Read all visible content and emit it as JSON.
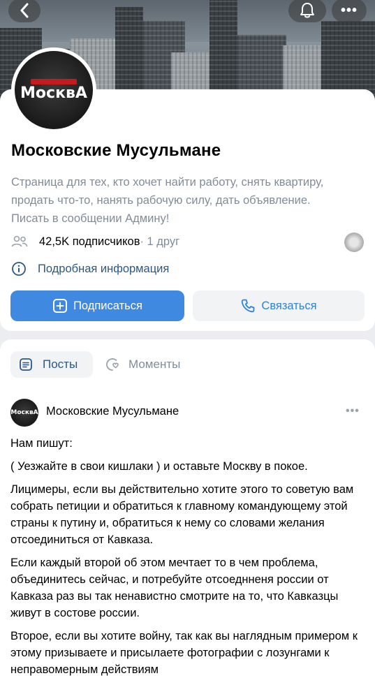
{
  "header": {
    "back_icon": "chevron-left-icon",
    "bell_icon": "bell-icon",
    "more_icon": "more-horizontal-icon",
    "more_label": "•••"
  },
  "profile": {
    "avatar_logo_text": "МосквА",
    "name": "Московские Мусульмане",
    "description": "Страница для тех, кто хочет найти работу, снять квартиру, продать что-то, нанять рабочую силу, дать объявление. Писать в сообщении Админу!",
    "subscribers": "42,5K подписчиков",
    "friends": " · 1 друг",
    "info_link": "Подробная информация",
    "subscribe_button": "Подписаться",
    "contact_button": "Связаться"
  },
  "feed": {
    "tabs": [
      {
        "label": "Посты",
        "active": true
      },
      {
        "label": "Моменты",
        "active": false
      }
    ],
    "post": {
      "author": "Московские Мусульмане",
      "avatar_text": "МосквА",
      "more_label": "•••",
      "paragraphs": [
        "Нам пишут:",
        "( Уезжайте в свои кишлаки ) и оставьте Москву в покое.",
        "Лицимеры, если вы действительно хотите этого то советую вам собрать петиции и обратиться к главному командующему этой страны к путину и, обратиться к нему со словами желания отсоединиться от Кавказа.",
        "Если каждый второй об этом мечтает то в чем проблема, объединитесь сейчас, и потребуйте отсоеднненя россии от Кавказа раз вы так ненавистно смотрите на то, что Кавказцы живут в состове россии.",
        "Второе, если вы хотите войну, так как вы наглядным примером к этому призываете и присылаете фотографии с лозунгами к неправомерным действиям"
      ]
    }
  },
  "colors": {
    "accent": "#3f8ae0",
    "link": "#2a5885",
    "secondary_text": "#818c99",
    "background": "#ebedf0"
  }
}
